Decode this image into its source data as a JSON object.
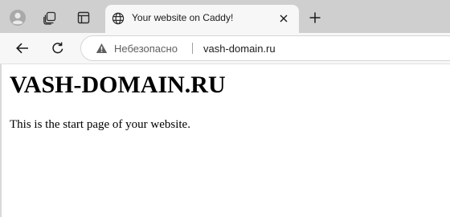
{
  "browser": {
    "tab": {
      "title": "Your website on Caddy!",
      "favicon": "globe-icon",
      "close_icon": "close-icon"
    },
    "tabbar_icons": [
      "profile-avatar-icon",
      "workspaces-icon",
      "tab-actions-icon"
    ],
    "new_tab_icon": "plus-icon",
    "nav": {
      "back_icon": "back-arrow-icon",
      "refresh_icon": "refresh-icon"
    },
    "address_bar": {
      "security_icon": "warning-icon",
      "security_label": "Небезопасно",
      "url": "vash-domain.ru"
    }
  },
  "page": {
    "heading": "VASH-DOMAIN.RU",
    "text": "This is the start page of your website."
  },
  "colors": {
    "tabbar_bg": "#cfcfcf",
    "toolbar_bg": "#f7f7f7",
    "page_bg": "#ffffff"
  }
}
